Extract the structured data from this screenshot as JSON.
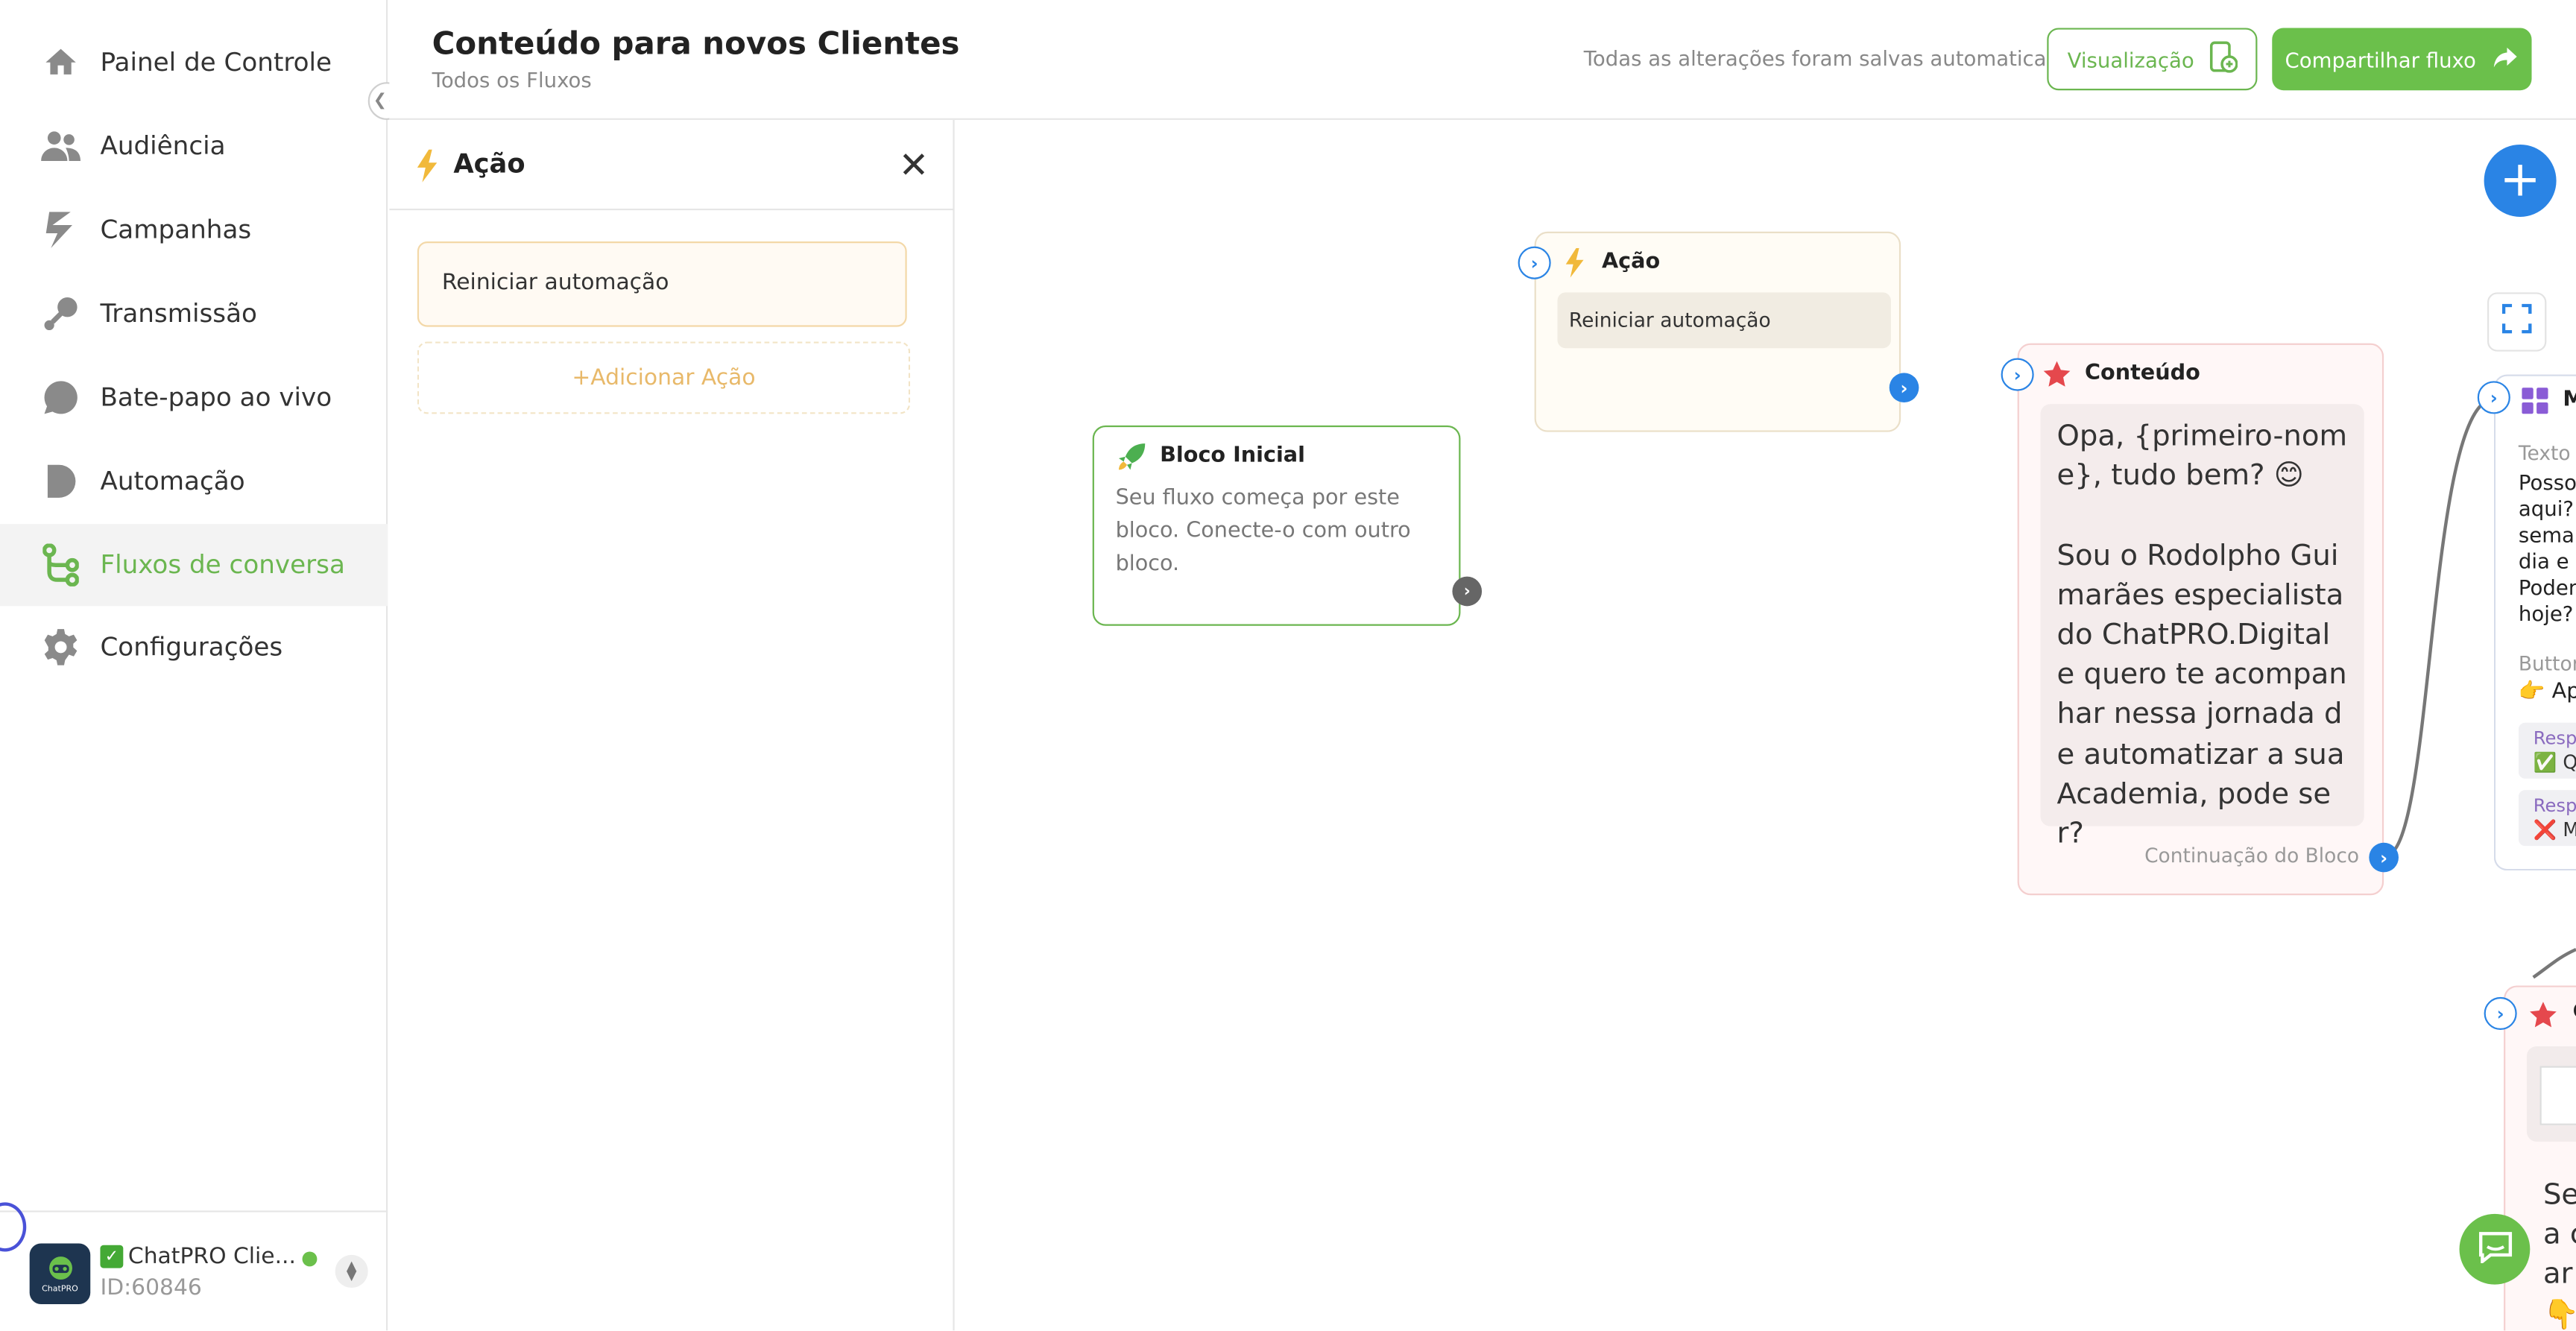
{
  "sidebar": {
    "items": [
      {
        "label": "Painel de Controle",
        "icon": "home-icon"
      },
      {
        "label": "Audiência",
        "icon": "users-icon"
      },
      {
        "label": "Campanhas",
        "icon": "campaign-icon"
      },
      {
        "label": "Transmissão",
        "icon": "broadcast-icon"
      },
      {
        "label": "Bate-papo ao vivo",
        "icon": "chat-bubble-icon"
      },
      {
        "label": "Automação",
        "icon": "automation-icon"
      },
      {
        "label": "Fluxos de conversa",
        "icon": "flow-icon"
      },
      {
        "label": "Configurações",
        "icon": "gear-icon"
      }
    ],
    "active_index": 6,
    "account": {
      "name": "ChatPRO Clie...",
      "id": "ID:60846",
      "status": "online"
    }
  },
  "header": {
    "title": "Conteúdo para novos Clientes",
    "breadcrumb": "Todos os Fluxos",
    "autosave": "Todas as alterações foram salvas automaticamente",
    "preview_label": "Visualização",
    "share_label": "Compartilhar fluxo"
  },
  "panel": {
    "title": "Ação",
    "action_item": "Reiniciar automação",
    "add_label": "+Adicionar Ação"
  },
  "canvas": {
    "start_node": {
      "title": "Bloco Inicial",
      "description": "Seu fluxo começa por este bloco. Conecte-o com outro bloco."
    },
    "action_node": {
      "title": "Ação",
      "action": "Reiniciar automação"
    },
    "content_node": {
      "title": "Conteúdo",
      "message": "Opa, {primeiro-nome}, tudo bem? 😊\n\nSou o Rodolpho Guimarães especialista do ChatPRO.Digital e quero te acompanhar nessa jornada de automatizar a sua Academia, pode ser?",
      "continuation": "Continuação do Bloco"
    },
    "menu_node": {
      "title": "M",
      "text_label": "Texto c",
      "text_lines": [
        "Posso",
        "aqui?",
        "semar",
        "dia e a",
        "Poden",
        "hoje?"
      ],
      "buttons_label": "Button",
      "button_text": "👉 Ape",
      "responses": [
        {
          "label": "Respo",
          "value": "✅ Qu"
        },
        {
          "label": "Respo",
          "value": "❌ Me"
        }
      ]
    },
    "content_node_2": {
      "title": "C",
      "lines": [
        "Se",
        "a c",
        "ar",
        "👇"
      ]
    }
  },
  "colors": {
    "brand_green": "#6bc04b",
    "accent_blue": "#2a84e5",
    "action_yellow": "#f1b93b",
    "content_red": "#e5484d"
  }
}
